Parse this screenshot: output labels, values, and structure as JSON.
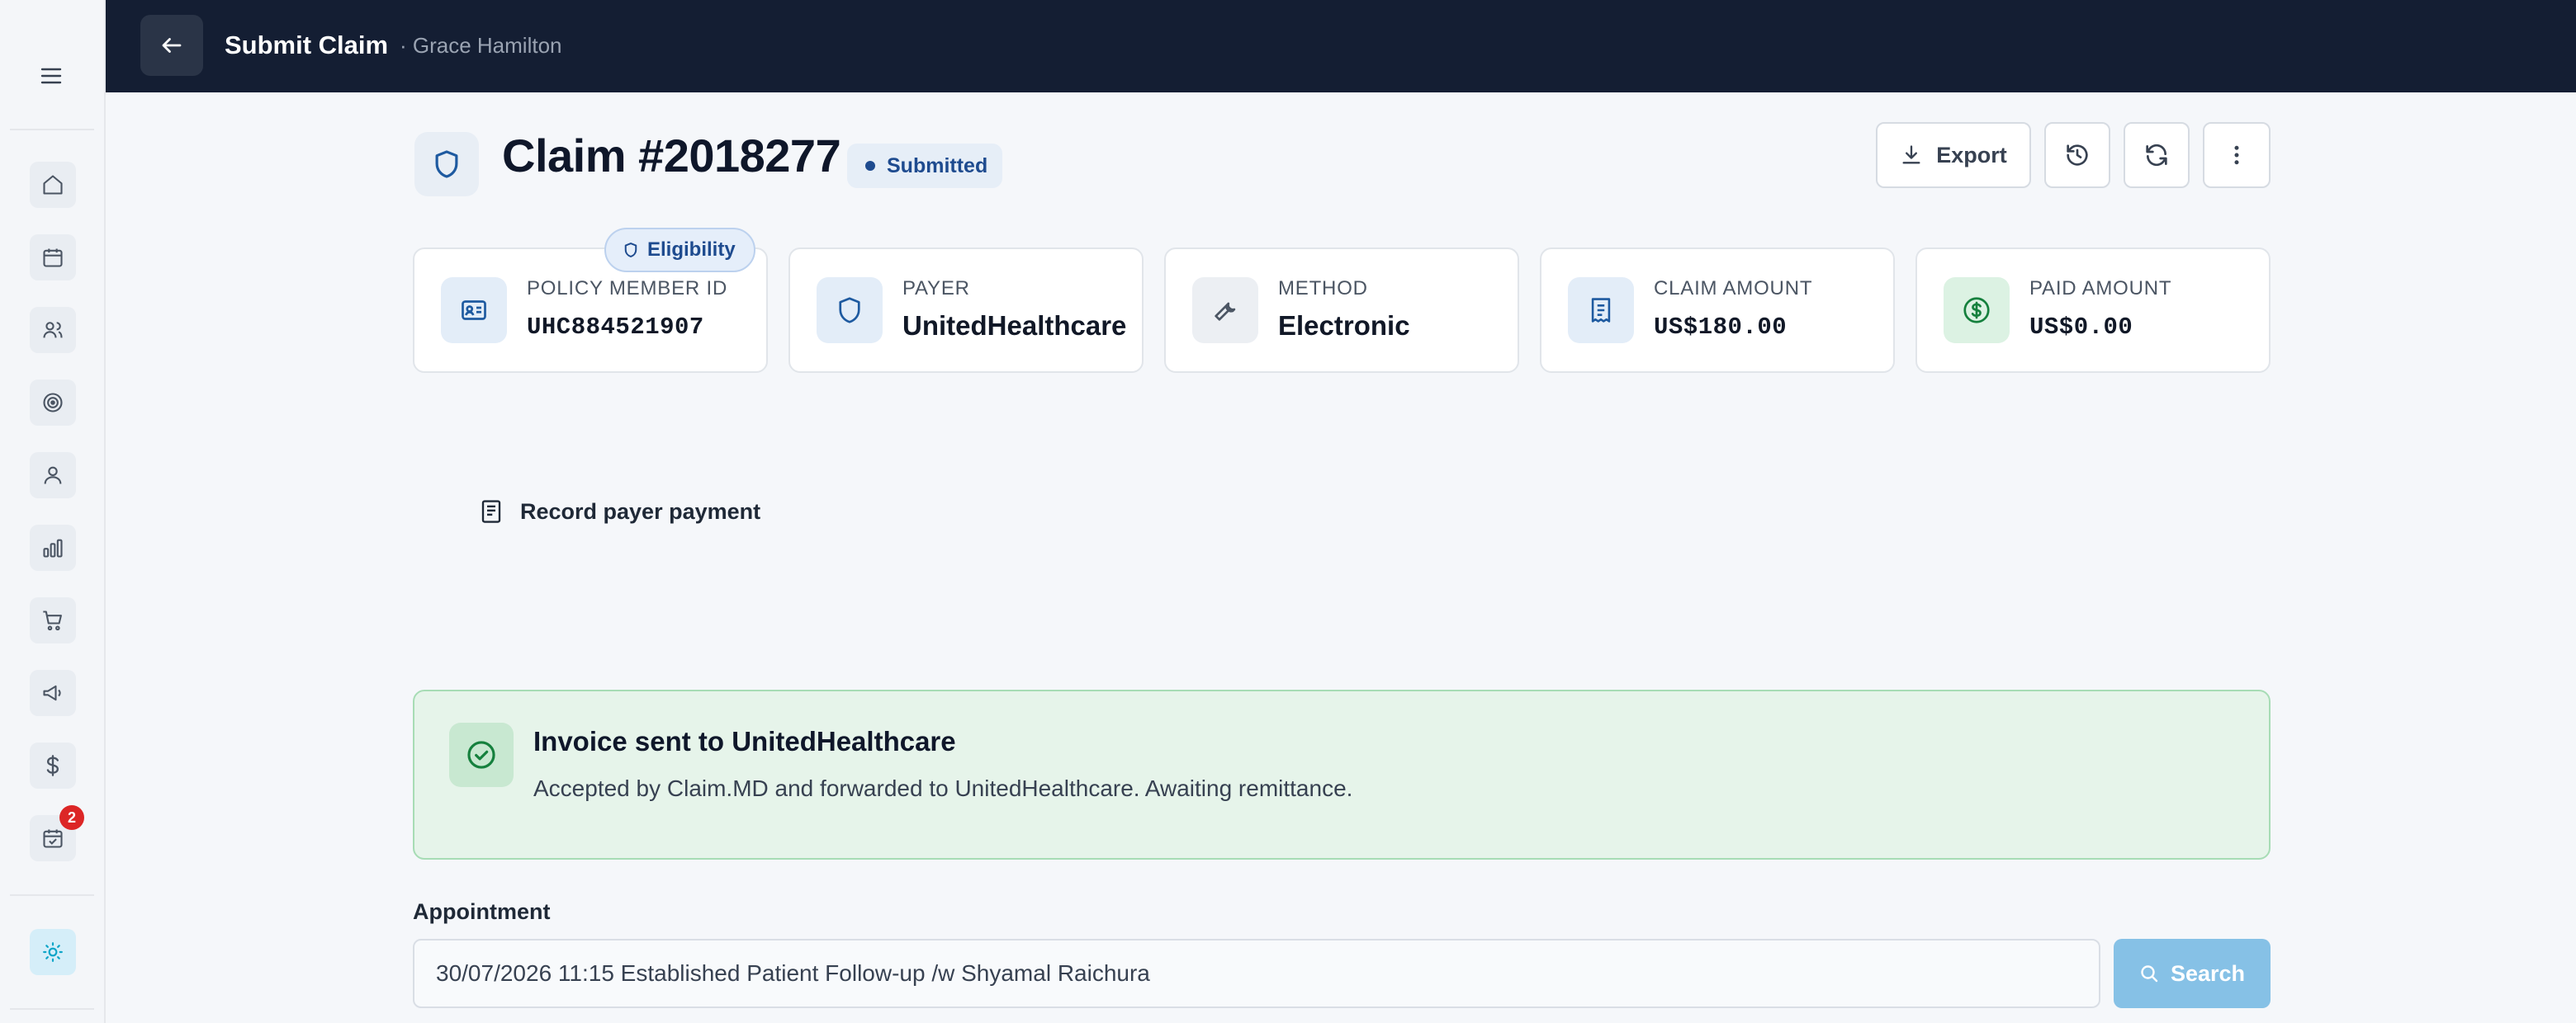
{
  "topbar": {
    "title": "Submit Claim",
    "subtitle": "· Grace Hamilton"
  },
  "sidebar": {
    "items": [
      {
        "icon": "home-icon"
      },
      {
        "icon": "calendar-icon"
      },
      {
        "icon": "users-icon"
      },
      {
        "icon": "target-icon"
      },
      {
        "icon": "user-icon"
      },
      {
        "icon": "bar-chart-icon"
      },
      {
        "icon": "cart-icon"
      },
      {
        "icon": "megaphone-icon"
      },
      {
        "icon": "dollar-icon"
      },
      {
        "icon": "calendar-check-icon",
        "badge": "2"
      },
      {
        "icon": "sun-icon",
        "active": true
      }
    ]
  },
  "claim": {
    "title": "Claim #2018277",
    "status": "Submitted"
  },
  "actions": {
    "export_label": "Export"
  },
  "eligibility_label": "Eligibility",
  "cards": [
    {
      "label": "Policy Member ID",
      "value": "UHC884521907"
    },
    {
      "label": "Payer",
      "value": "UnitedHealthcare"
    },
    {
      "label": "Method",
      "value": "Electronic"
    },
    {
      "label": "Claim Amount",
      "value": "US$180.00"
    },
    {
      "label": "Paid Amount",
      "value": "US$0.00"
    }
  ],
  "record_payment_label": "Record payer payment",
  "banner": {
    "title": "Invoice sent to UnitedHealthcare",
    "text": "Accepted by Claim.MD and forwarded to UnitedHealthcare. Awaiting remittance."
  },
  "appointment": {
    "label": "Appointment",
    "value": "30/07/2026 11:15 Established Patient Follow-up /w Shyamal Raichura",
    "search_label": "Search"
  },
  "colors": {
    "topbar": "#141e33",
    "success_bg": "#e6f4ea",
    "accent": "#1e4b8f",
    "search_button": "#86c1e6"
  }
}
